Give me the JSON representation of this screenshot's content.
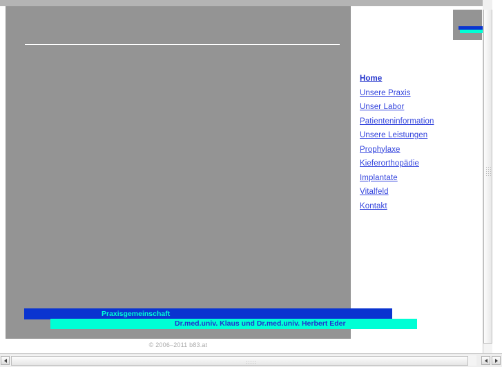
{
  "page": {
    "background_color": "#ffffff",
    "panel_color": "#949494",
    "top_strip_color": "#b4b4b4"
  },
  "logo": {
    "name": "site-logo",
    "square_color": "#949494",
    "bar_blue_color": "#0a34d0",
    "bar_cyan_color": "#00ffd5"
  },
  "nav": {
    "items": [
      {
        "label": "Home",
        "active": true
      },
      {
        "label": "Unsere Praxis",
        "active": false
      },
      {
        "label": "Unser Labor",
        "active": false
      },
      {
        "label": "Patienteninformation",
        "active": false
      },
      {
        "label": "Unsere Leistungen",
        "active": false
      },
      {
        "label": "Prophylaxe",
        "active": false
      },
      {
        "label": "Kieferorthopädie",
        "active": false
      },
      {
        "label": "Implantate",
        "active": false
      },
      {
        "label": "Vitalfeld",
        "active": false
      },
      {
        "label": "Kontakt",
        "active": false
      }
    ],
    "link_color": "#3344dd"
  },
  "banners": {
    "primary": {
      "text": "Praxisgemeinschaft",
      "background": "#0a34d0",
      "text_color": "#00ffd5"
    },
    "secondary": {
      "text": "Dr.med.univ. Klaus und Dr.med.univ. Herbert Eder",
      "background": "#00ffd5",
      "text_color": "#2233cc"
    }
  },
  "footer": {
    "copyright": "© 2006–2011 b83.at"
  },
  "scrollbars": {
    "vertical": {
      "up_arrow": "scroll-up-arrow"
    },
    "horizontal": {
      "left_arrow": "scroll-left-arrow",
      "right_arrow_1": "scroll-right-arrow",
      "right_arrow_2": "scroll-right-arrow"
    }
  }
}
